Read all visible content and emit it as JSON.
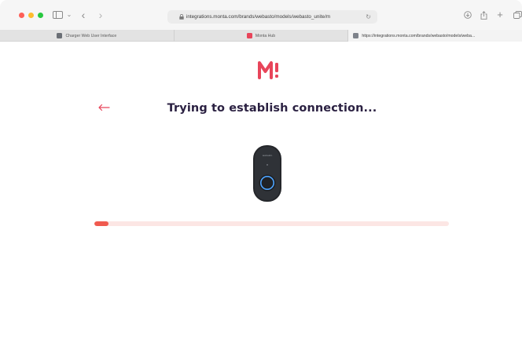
{
  "browser": {
    "url": "integrations.monta.com/brands/webasto/models/webasto_unite/m",
    "tabs": [
      {
        "label": "Charger Web User Interface",
        "active": false
      },
      {
        "label": "Monta Hub",
        "active": false
      },
      {
        "label": "https://integrations.monta.com/brands/webasto/models/weba...",
        "active": true
      }
    ],
    "icons": [
      "sidebar-icon",
      "back-icon",
      "forward-icon",
      "lock-icon",
      "reload-icon",
      "download-icon",
      "share-icon",
      "new-tab-icon",
      "tab-overview-icon"
    ]
  },
  "page": {
    "logo_text": "M",
    "title": "Trying to establish connection...",
    "progress_fraction": 0.04,
    "charger_brand": "webasto"
  },
  "colors": {
    "brand": "#e8455a",
    "title": "#2b2142",
    "progress_fill": "#f05a4f",
    "progress_track": "#fce6e4",
    "charger_body": "#2a2c30",
    "charger_ring": "#4ea4ff"
  }
}
